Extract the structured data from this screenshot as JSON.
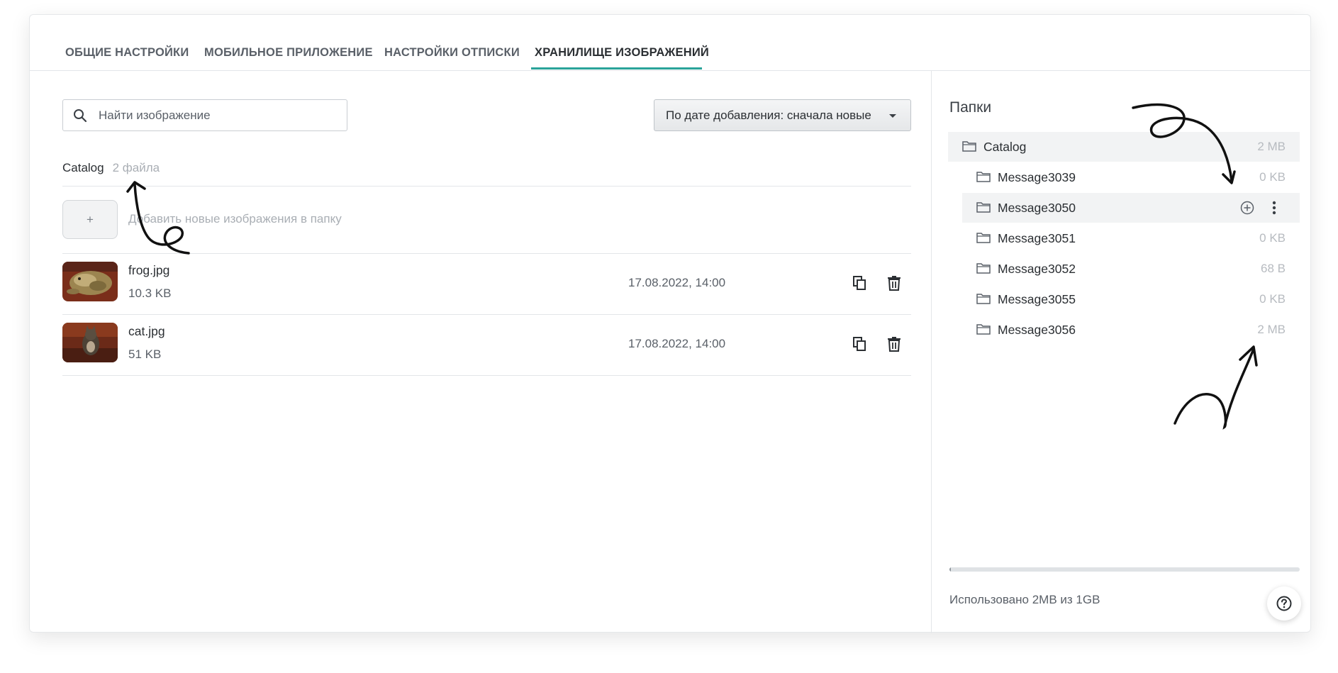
{
  "tabs": [
    {
      "label": "ОБЩИЕ НАСТРОЙКИ"
    },
    {
      "label": "МОБИЛЬНОЕ ПРИЛОЖЕНИЕ"
    },
    {
      "label": "НАСТРОЙКИ ОТПИСКИ"
    },
    {
      "label": "ХРАНИЛИЩЕ ИЗОБРАЖЕНИЙ"
    }
  ],
  "active_tab": "ХРАНИЛИЩЕ ИЗОБРАЖЕНИЙ",
  "search": {
    "placeholder": "Найти изображение",
    "value": "",
    "icon": "search-icon"
  },
  "sort": {
    "selected": "По дате добавления: сначала новые",
    "icon": "caret-down-icon"
  },
  "current_folder": {
    "name": "Catalog",
    "count": "2 файла"
  },
  "add_images": {
    "button": "+",
    "text": "Добавить новые изображения в папку"
  },
  "files": [
    {
      "name": "frog.jpg",
      "size": "10.3 KB",
      "date": "17.08.2022, 14:00"
    },
    {
      "name": "cat.jpg",
      "size": "51 KB",
      "date": "17.08.2022, 14:00"
    }
  ],
  "folders": {
    "title": "Папки",
    "root": {
      "name": "Catalog",
      "size": "2 MB"
    },
    "children": [
      {
        "name": "Message3039",
        "size": "0 KB"
      },
      {
        "name": "Message3050",
        "size": ""
      },
      {
        "name": "Message3051",
        "size": "0 KB"
      },
      {
        "name": "Message3052",
        "size": "68 B"
      },
      {
        "name": "Message3055",
        "size": "0 KB"
      },
      {
        "name": "Message3056",
        "size": "2 MB"
      }
    ]
  },
  "usage": {
    "text": "Использовано 2MB из 1GB",
    "fraction": 0.002
  },
  "colors": {
    "accent": "#2aa39a",
    "text": "#2b2f33",
    "muted": "#a9aeb4"
  }
}
